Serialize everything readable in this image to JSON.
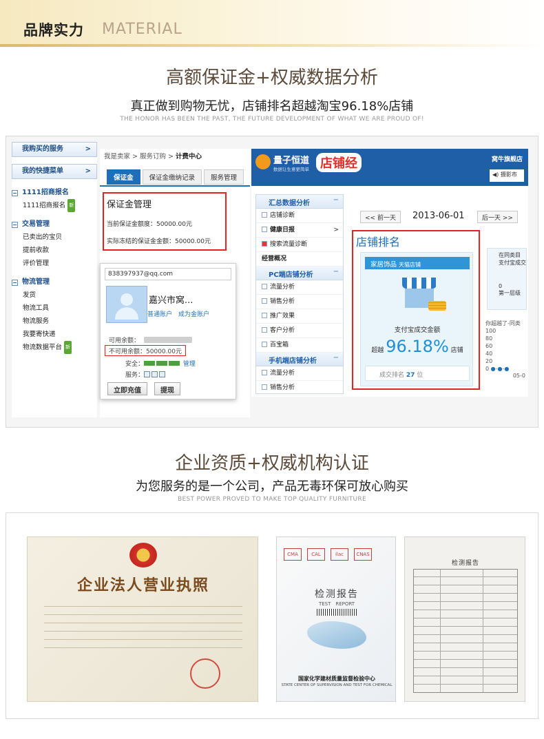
{
  "header": {
    "title_cn": "品牌实力",
    "title_en": "MATERIAL"
  },
  "section1": {
    "heading": "高额保证金+权威数据分析",
    "subheading": "真正做到购物无忧，店铺排名超越淘宝96.18%店铺",
    "tagline": "THE HONOR HAS BEEN THE PAST, THE FUTURE DEVELOPMENT OF WHAT WE ARE PROUD OF!"
  },
  "left_panel": {
    "buttons": [
      {
        "label": "我购买的服务",
        "arrow": ">"
      },
      {
        "label": "我的快捷菜单",
        "arrow": ">"
      }
    ],
    "groups": [
      {
        "title": "1111招商报名",
        "items": [
          {
            "label": "1111招商报名",
            "badge": "新"
          }
        ]
      },
      {
        "title": "交易管理",
        "items": [
          {
            "label": "已卖出的宝贝"
          },
          {
            "label": "提前收款"
          },
          {
            "label": "评价管理"
          }
        ]
      },
      {
        "title": "物流管理",
        "items": [
          {
            "label": "发货"
          },
          {
            "label": "物流工具"
          },
          {
            "label": "物流服务"
          },
          {
            "label": "我要寄快递"
          },
          {
            "label": "物流数据平台",
            "badge": "新"
          }
        ]
      }
    ]
  },
  "middle_panel": {
    "breadcrumb": [
      "我是卖家",
      "服务订购",
      "计费中心"
    ],
    "tabs": [
      "保证金",
      "保证金缴纳记录",
      "服务管理"
    ],
    "deposit_title": "保证金管理",
    "deposit_current_label": "当前保证金额度：",
    "deposit_current_value": "50000.00元",
    "deposit_frozen_label": "实际冻结的保证金金额：",
    "deposit_frozen_value": "50000.00元"
  },
  "popup": {
    "email": "838397937@qq.com",
    "name": "嘉兴市窝...",
    "link1": "普通账户",
    "link2": "成为金账户",
    "available_label": "可用余额：",
    "unavailable_label": "不可用余额：",
    "unavailable_value": "50000.00元",
    "security_label": "安全：",
    "security_link": "管理",
    "service_label": "服务：",
    "recharge_btn": "立即充值",
    "withdraw_btn": "提现"
  },
  "right_panel": {
    "logo_main": "量子恒道",
    "logo_sub": "数据让生意更简单",
    "logo_badge": "店铺经",
    "shop_name": "窝牛旗舰店",
    "speaker_text": "摄影市",
    "nav": [
      {
        "type": "head",
        "label": "汇总数据分析"
      },
      {
        "type": "item",
        "label": "店铺诊断"
      },
      {
        "type": "item",
        "label": "健康日报",
        "bold": true,
        "arrow": ">"
      },
      {
        "type": "item",
        "label": "搜索流量诊断"
      },
      {
        "type": "item",
        "label": "经营概况",
        "bold": true
      },
      {
        "type": "head",
        "label": "PC端店铺分析"
      },
      {
        "type": "item",
        "label": "流量分析"
      },
      {
        "type": "item",
        "label": "销售分析"
      },
      {
        "type": "item",
        "label": "推广效果"
      },
      {
        "type": "item",
        "label": "客户分析"
      },
      {
        "type": "item",
        "label": "百宝箱"
      },
      {
        "type": "head",
        "label": "手机端店铺分析"
      },
      {
        "type": "item",
        "label": "流量分析"
      },
      {
        "type": "item",
        "label": "销售分析"
      }
    ],
    "prev_day": "<< 前一天",
    "date": "2013-06-01",
    "next_day": "后一天 >>",
    "rank_title": "店铺排名",
    "category": "家居饰品",
    "category_sub": "天猫店铺",
    "metric_label": "支付宝成交金额",
    "beat_prefix": "超越",
    "beat_pct": "96.18%",
    "beat_suffix": "店铺",
    "deal_rank_label": "成交排名",
    "deal_rank_value": "27",
    "deal_rank_unit": "位",
    "side_text1": "在同类目",
    "side_text2": "支付宝成交",
    "side_num": "0",
    "side_text3": "第一层级",
    "chart_title": "你超越了-同类",
    "chart_ticks": [
      "100",
      "80",
      "60",
      "40",
      "20",
      "0"
    ],
    "chart_x": "05-0"
  },
  "section2": {
    "heading": "企业资质+权威机构认证",
    "subheading": "为您服务的是一个公司，产品无毒环保可放心购买",
    "tagline": "BEST POWER PROVED TO MAKE TOP QUALITY FURNITURE"
  },
  "certs": {
    "license_title": "企业法人营业执照",
    "report_title": "检测报告",
    "report_sub": "TEST　REPORT",
    "report_logos": [
      "CMA",
      "CAL",
      "ilac",
      "CNAS"
    ],
    "report_org": "国家化学建材质量监督检验中心",
    "report_org_en": "STATE CENTER OF SUPERVISION AND TEST FOR CHEMICAL",
    "detail_title": "检测报告"
  }
}
